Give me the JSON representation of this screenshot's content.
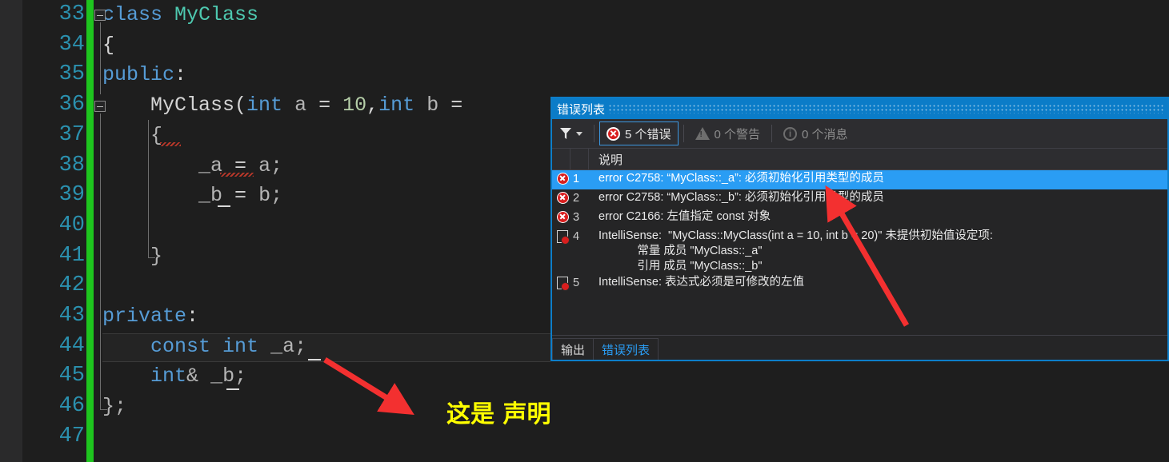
{
  "editor": {
    "lines": [
      {
        "number": "33",
        "text": "class MyClass"
      },
      {
        "number": "34",
        "text": "{"
      },
      {
        "number": "35",
        "text": "public:"
      },
      {
        "number": "36",
        "text": "    MyClass(int a = 10,int b ="
      },
      {
        "number": "37",
        "text": "    {"
      },
      {
        "number": "38",
        "text": "        _a = a;"
      },
      {
        "number": "39",
        "text": "        _b = b;"
      },
      {
        "number": "40",
        "text": ""
      },
      {
        "number": "41",
        "text": "    }"
      },
      {
        "number": "42",
        "text": ""
      },
      {
        "number": "43",
        "text": "private:"
      },
      {
        "number": "44",
        "text": "    const int _a;"
      },
      {
        "number": "45",
        "text": "    int& _b;"
      },
      {
        "number": "46",
        "text": "};"
      },
      {
        "number": "47",
        "text": ""
      }
    ],
    "annotation": "这是 声明",
    "annotation_color": "#ffff00"
  },
  "error_panel": {
    "title": "错误列表",
    "toolbar": {
      "filter_icon": "filter-icon",
      "errors_label": "5 个错误",
      "warnings_label": "0 个警告",
      "messages_label": "0 个消息"
    },
    "columns": [
      "",
      "",
      "说明"
    ],
    "rows": [
      {
        "icon": "error-icon",
        "number": "1",
        "description": "error C2758: “MyClass::_a”: 必须初始化引用类型的成员",
        "selected": true
      },
      {
        "icon": "error-icon",
        "number": "2",
        "description": "error C2758: “MyClass::_b”: 必须初始化引用类型的成员",
        "selected": false
      },
      {
        "icon": "error-icon",
        "number": "3",
        "description": "error C2166: 左值指定 const 对象",
        "selected": false
      },
      {
        "icon": "document-error-icon",
        "number": "4",
        "description": "IntelliSense:  \"MyClass::MyClass(int a = 10, int b = 20)\" 未提供初始值设定项:\n            常量 成员 \"MyClass::_a\"\n            引用 成员 \"MyClass::_b\"",
        "selected": false
      },
      {
        "icon": "document-error-icon",
        "number": "5",
        "description": "IntelliSense: 表达式必须是可修改的左值",
        "selected": false
      }
    ],
    "tabs": [
      {
        "label": "输出",
        "active": false
      },
      {
        "label": "错误列表",
        "active": true
      }
    ]
  },
  "colors": {
    "selection_blue": "#2a9df4",
    "title_blue": "#0b7cc8",
    "arrow_red": "#f33030",
    "change_bar_green": "#1ec51e",
    "editor_bg": "#1e1e1e"
  }
}
